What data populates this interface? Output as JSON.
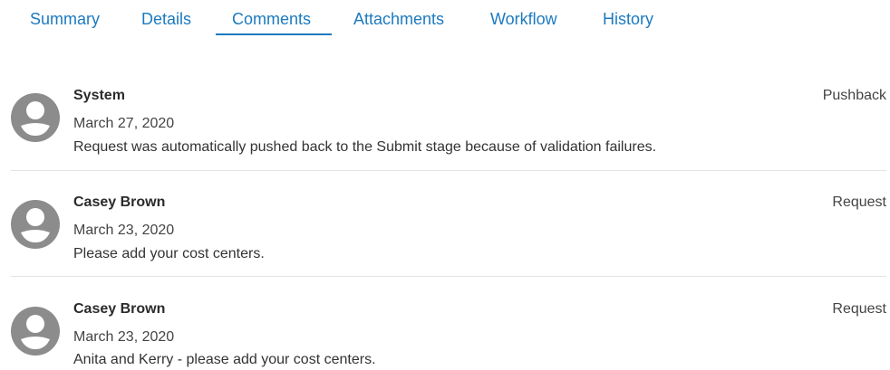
{
  "tabs": [
    {
      "label": "Summary"
    },
    {
      "label": "Details"
    },
    {
      "label": "Comments",
      "active": true
    },
    {
      "label": "Attachments"
    },
    {
      "label": "Workflow"
    },
    {
      "label": "History"
    }
  ],
  "comments": [
    {
      "author": "System",
      "date": "March 27, 2020",
      "text": "Request was automatically pushed back to the Submit stage because of validation failures.",
      "type": "Pushback"
    },
    {
      "author": "Casey Brown",
      "date": "March 23, 2020",
      "text": "Please add your cost centers.",
      "type": "Request"
    },
    {
      "author": "Casey Brown",
      "date": "March 23, 2020",
      "text": "Anita and Kerry - please add your cost centers.",
      "type": "Request"
    }
  ],
  "colors": {
    "tab_text": "#1c7abf",
    "avatar": "#8c8c8c",
    "divider": "#e3e3e3"
  },
  "icons": {
    "avatar": "user-avatar-icon"
  }
}
